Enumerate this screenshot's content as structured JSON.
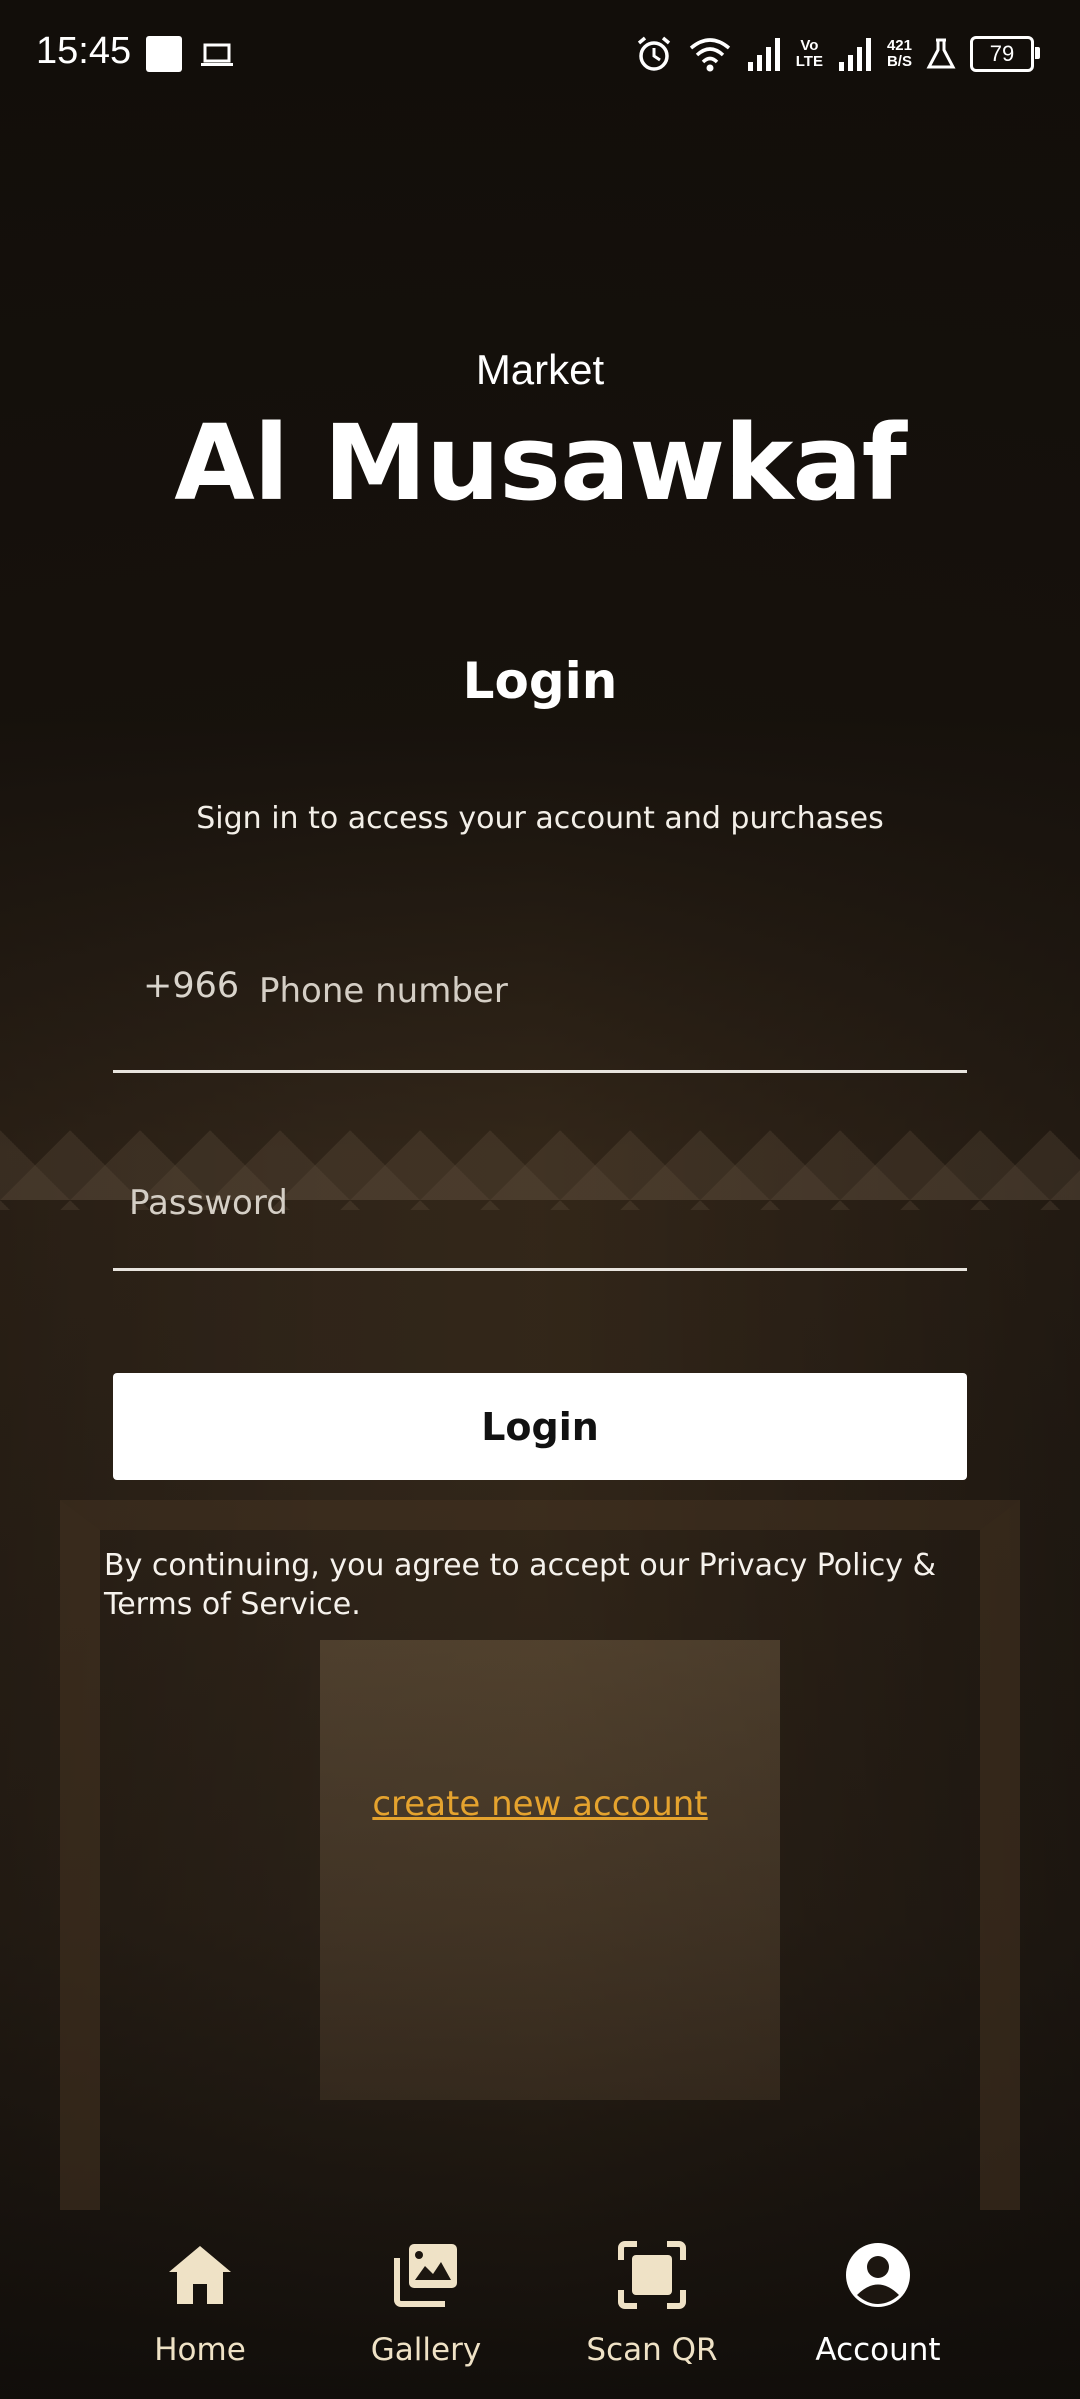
{
  "status_bar": {
    "time": "15:45",
    "speed_top": "421",
    "speed_bottom": "B/S",
    "network_label_top": "Vo",
    "network_label_bottom": "LTE",
    "battery": "79"
  },
  "header": {
    "subtitle": "Market",
    "brand": "Al Musawkaf"
  },
  "login": {
    "title": "Login",
    "tagline": "Sign in to access your account and purchases",
    "phone_prefix": "+966",
    "phone_placeholder": "Phone number",
    "password_placeholder": "Password",
    "button_label": "Login",
    "terms": "By continuing, you agree to accept our Privacy Policy & Terms of Service.",
    "create_account": "create new account"
  },
  "nav": {
    "items": [
      {
        "label": "Home",
        "icon": "home-icon"
      },
      {
        "label": "Gallery",
        "icon": "gallery-icon"
      },
      {
        "label": "Scan QR",
        "icon": "scan-qr-icon"
      },
      {
        "label": "Account",
        "icon": "account-icon",
        "active": true
      }
    ]
  },
  "colors": {
    "accent_link": "#e5a32e",
    "nav_icon": "#efe2c6",
    "button_bg": "#ffffff"
  }
}
